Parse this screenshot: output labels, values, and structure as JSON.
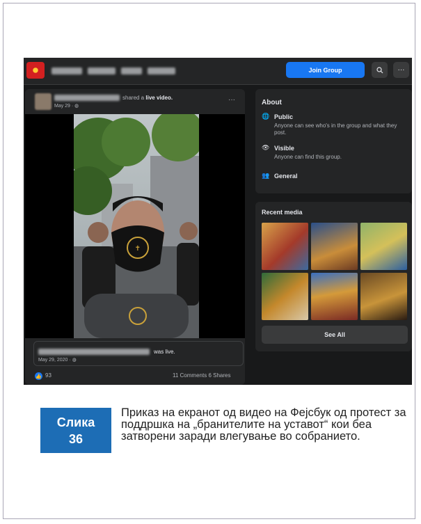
{
  "header": {
    "join_label": "Join Group",
    "search_icon": "search-icon",
    "more_label": "···"
  },
  "post": {
    "shared_prefix": "shared a",
    "shared_strong": "live video.",
    "date": "May 29 · ◍",
    "more": "···",
    "was_live": "was live.",
    "live_date": "May 29, 2020 · ◍",
    "likes": "93",
    "comments": "11 Comments",
    "shares": "6 Shares"
  },
  "about": {
    "title": "About",
    "public_title": "Public",
    "public_desc": "Anyone can see who's in the group and what they post.",
    "visible_title": "Visible",
    "visible_desc": "Anyone can find this group.",
    "general_title": "General"
  },
  "media": {
    "title": "Recent media",
    "see_all": "See All"
  },
  "figure": {
    "label_line1": "Слика",
    "label_line2": "36",
    "caption": "Приказ на екранот од видео на Фејсбук од протест за поддршка на „бранителите на уставот“ кои беа затворени заради влегување во собранието."
  },
  "colors": {
    "facebook_blue": "#1877f2",
    "badge_blue": "#1d6db5",
    "dark_bg": "#18191a",
    "card_bg": "#242526"
  }
}
